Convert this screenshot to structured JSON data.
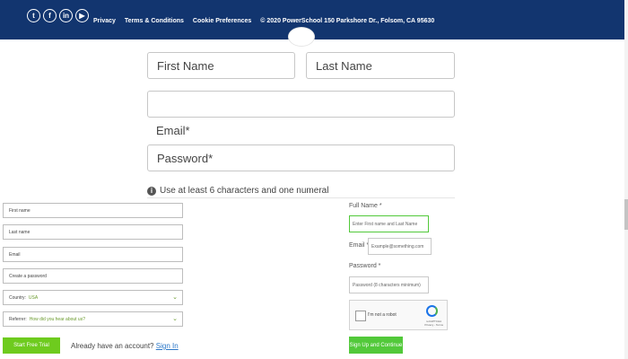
{
  "topbar": {
    "social": [
      {
        "icon": "twitter-icon",
        "glyph": "t"
      },
      {
        "icon": "facebook-icon",
        "glyph": "f"
      },
      {
        "icon": "linkedin-icon",
        "glyph": "in"
      },
      {
        "icon": "youtube-icon",
        "glyph": "▶"
      }
    ],
    "links": {
      "privacy": "Privacy",
      "terms": "Terms & Conditions",
      "cookies": "Cookie Preferences"
    },
    "copyright": "© 2020 PowerSchool 150 Parkshore Dr., Folsom, CA 95630",
    "background": "#12356f"
  },
  "main_form": {
    "first_name": "First Name",
    "last_name": "Last Name",
    "email_value": "",
    "email_label": "Email*",
    "password": "Password*",
    "hint": "Use at least 6 characters and one numeral"
  },
  "left_form": {
    "first_name": "First name",
    "last_name": "Last name",
    "email": "Email",
    "password": "Create a password",
    "country_label": "Country:",
    "country_value": "USA",
    "referrer_label": "Referrer:",
    "referrer_value": "How did you hear about us?",
    "start_button": "Start Free Trial",
    "already_text": "Already have an account?",
    "signin_link": "Sign In"
  },
  "right_form": {
    "full_name_label": "Full Name *",
    "full_name_placeholder": "Enter First name and Last Name",
    "email_label": "Email *",
    "email_placeholder": "Example@something.com",
    "password_label": "Password *",
    "password_placeholder": "Password (8 characters minimum)",
    "captcha_text": "I'm not a robot",
    "captcha_brand": "reCAPTCHA",
    "captcha_sub": "Privacy - Terms",
    "submit_button": "Sign Up and Continue",
    "accent": "#52c93a"
  }
}
